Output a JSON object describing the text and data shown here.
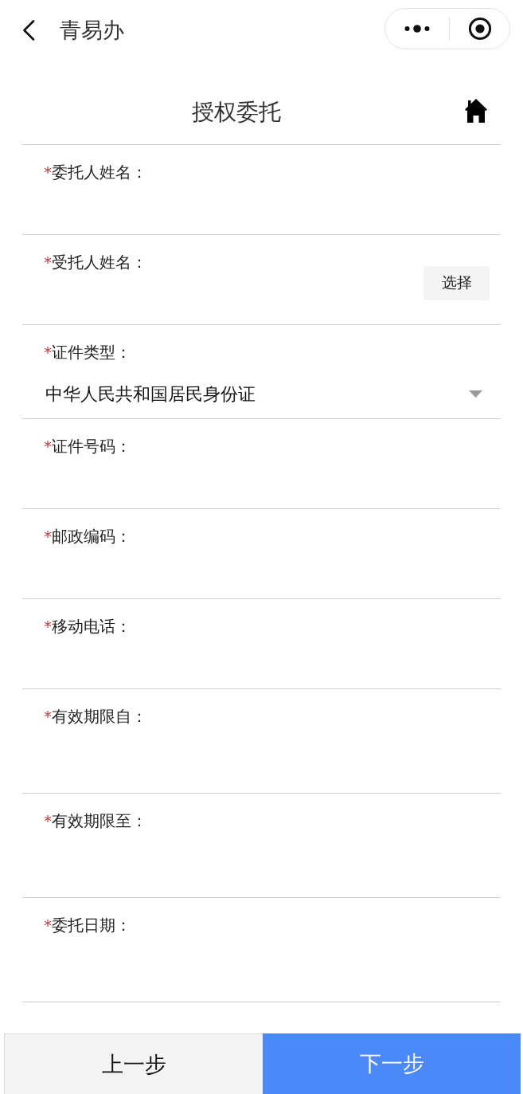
{
  "nav_bar": {
    "title": "青易办"
  },
  "page_header": {
    "title": "授权委托"
  },
  "form": {
    "fields": [
      {
        "kind": "input",
        "required_mark": "*",
        "label": "委托人姓名："
      },
      {
        "kind": "picker",
        "required_mark": "*",
        "label": "受托人姓名：",
        "button": "选择"
      },
      {
        "kind": "select",
        "required_mark": "*",
        "label": "证件类型：",
        "value": "中华人民共和国居民身份证"
      },
      {
        "kind": "input",
        "required_mark": "*",
        "label": "证件号码："
      },
      {
        "kind": "input",
        "required_mark": "*",
        "label": "邮政编码："
      },
      {
        "kind": "input",
        "required_mark": "*",
        "label": "移动电话："
      },
      {
        "kind": "date",
        "required_mark": "*",
        "label": "有效期限自："
      },
      {
        "kind": "date",
        "required_mark": "*",
        "label": "有效期限至："
      },
      {
        "kind": "date",
        "required_mark": "*",
        "label": "委托日期："
      }
    ]
  },
  "footer": {
    "buttons": [
      {
        "label": "上一步",
        "kind": "secondary"
      },
      {
        "label": "下一步",
        "kind": "primary"
      }
    ]
  }
}
